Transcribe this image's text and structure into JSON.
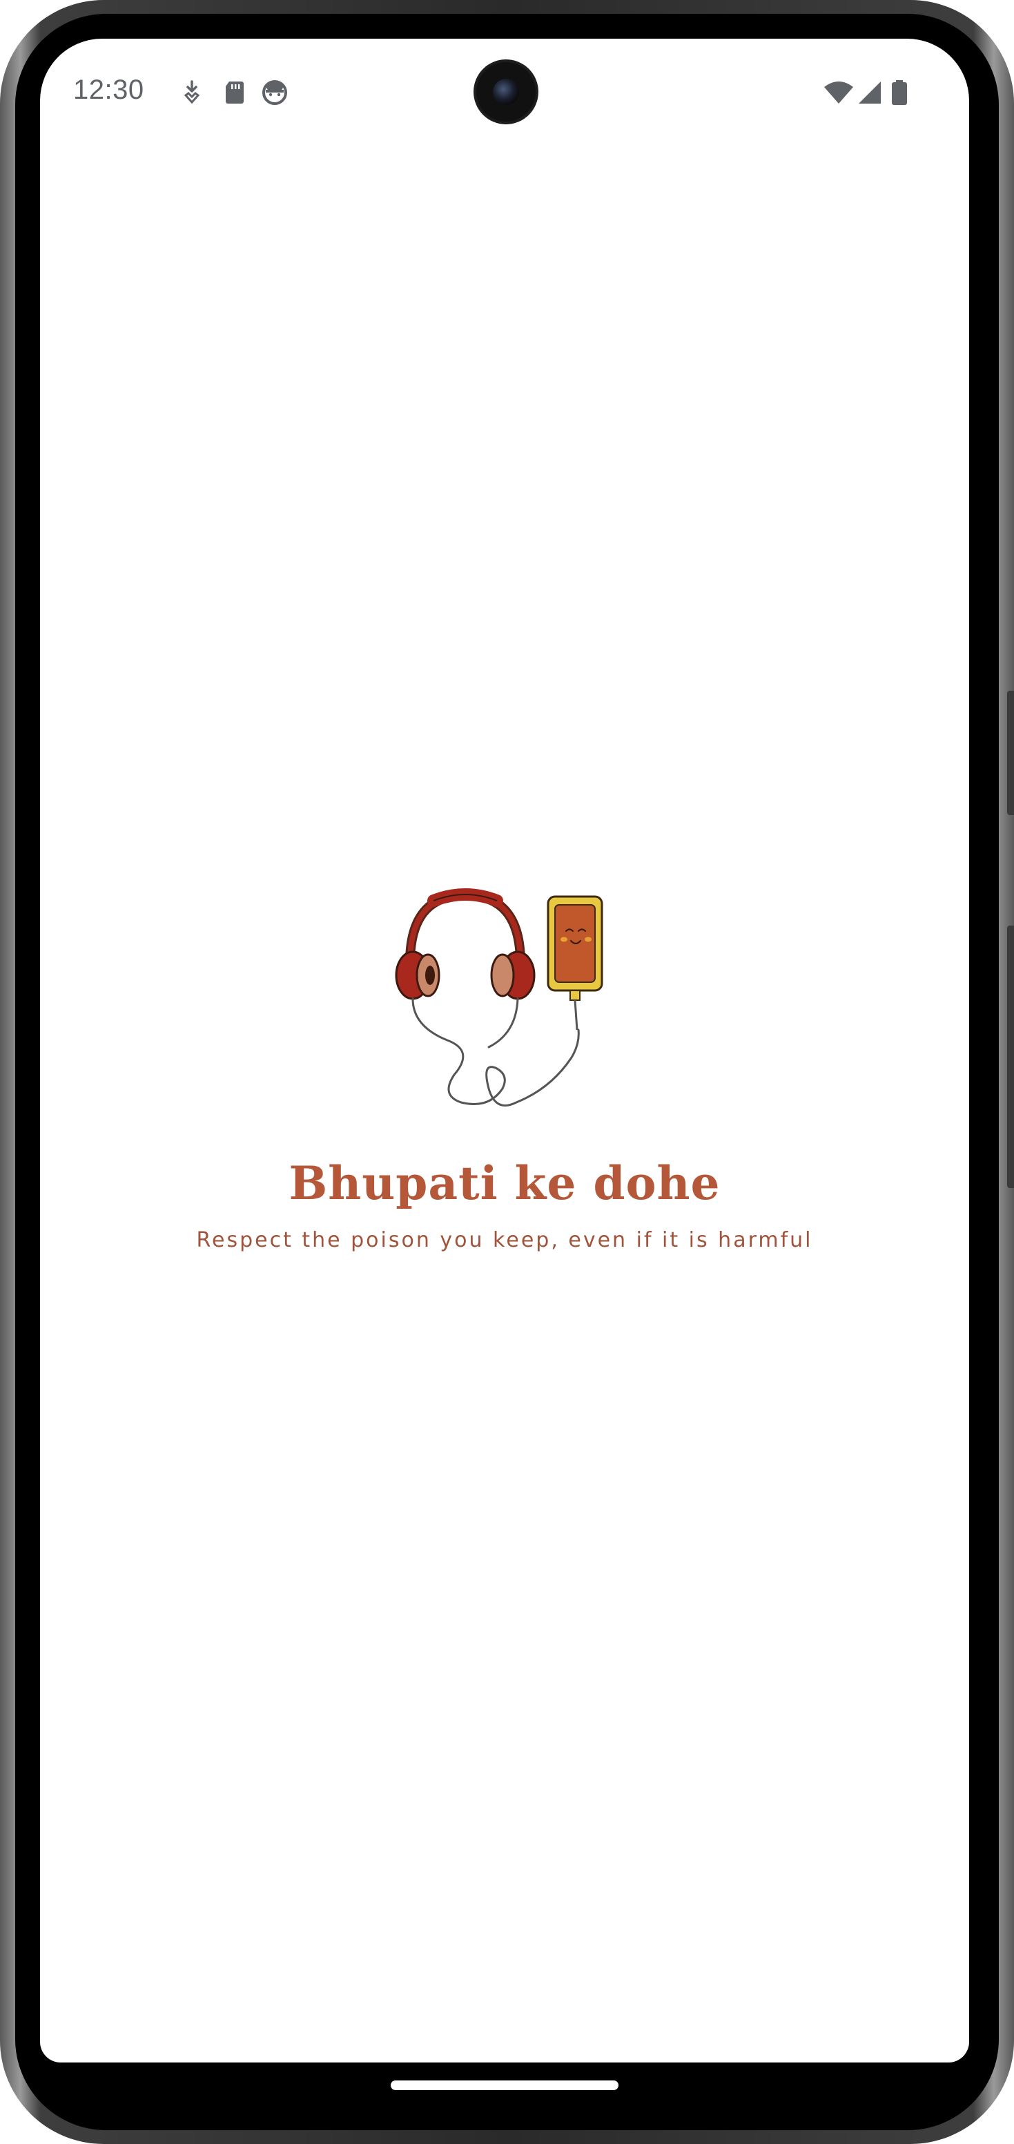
{
  "status_bar": {
    "time": "12:30",
    "left_icons": [
      "download-notification-icon",
      "sd-card-icon",
      "android-face-icon"
    ],
    "right_icons": [
      "wifi-icon",
      "cellular-signal-icon",
      "battery-icon"
    ]
  },
  "splash": {
    "title": "Bhupati ke dohe",
    "tagline": "Respect the poison you keep, even if it is harmful",
    "logo_icon": "headphones-phone-logo-icon"
  },
  "colors": {
    "accent": "#b5583a",
    "headphone_band": "#a8281e",
    "phone_body": "#c0582c",
    "phone_frame": "#e8c840",
    "status_icon": "#5f6368"
  }
}
